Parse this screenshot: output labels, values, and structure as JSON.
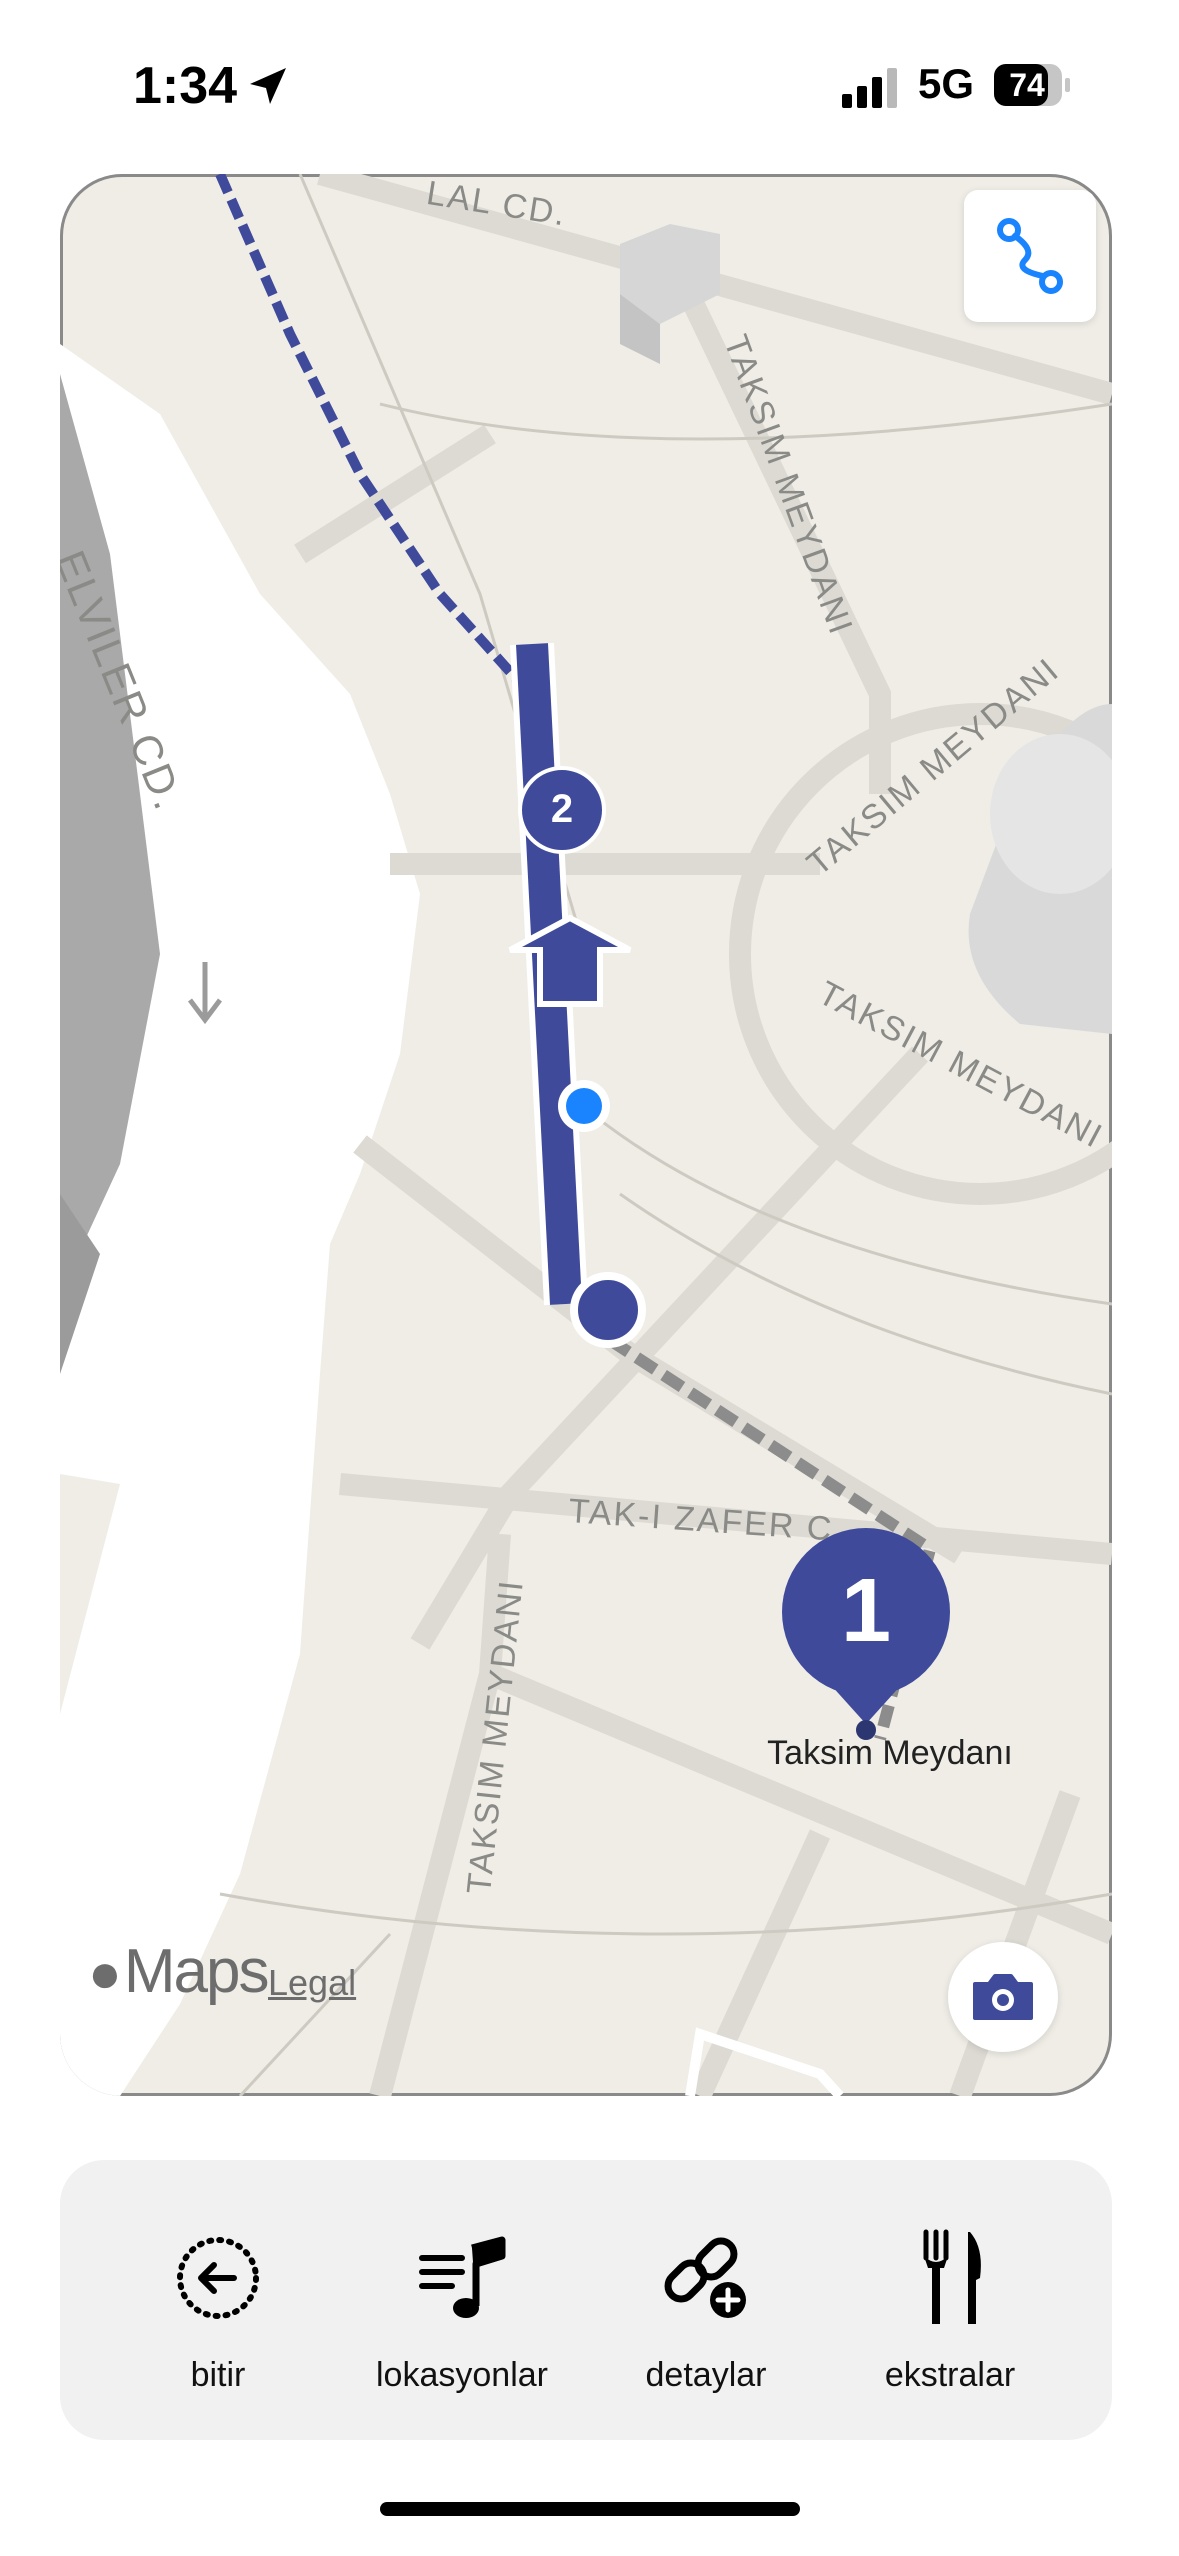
{
  "status_bar": {
    "time": "1:34",
    "network": "5G",
    "battery": "74"
  },
  "map": {
    "street_labels": {
      "top": "LAL CD.",
      "left": "ELVILER CD.",
      "taksim_top": "TAKSIM MEYDANI",
      "taksim_circle_top": "TAKSIM MEYDANI",
      "taksim_circle_bottom": "TAKSIM MEYDANI",
      "tak_i_zafer": "TAK-I ZAFER C",
      "taksim_bottom": "TAKSIM MEYDANI"
    },
    "markers": {
      "stop_1": "1",
      "stop_2": "2"
    },
    "poi_label": "Taksim Meydanı",
    "attribution": {
      "maps": "Maps",
      "legal": "Legal"
    },
    "colors": {
      "route": "#3f4b9a",
      "user_location": "#1a84ff"
    }
  },
  "toolbar": {
    "items": [
      {
        "label": "bitir",
        "icon": "back-circle-icon"
      },
      {
        "label": "lokasyonlar",
        "icon": "music-list-icon"
      },
      {
        "label": "detaylar",
        "icon": "link-add-icon"
      },
      {
        "label": "ekstralar",
        "icon": "fork-knife-icon"
      }
    ]
  }
}
